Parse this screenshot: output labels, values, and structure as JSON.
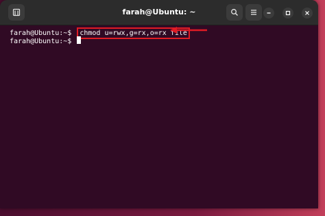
{
  "window": {
    "title": "farah@Ubuntu: ~"
  },
  "terminal": {
    "lines": [
      {
        "prompt": "farah@Ubuntu:~$",
        "command": "chmod u=rwx,g=rx,o=rx file"
      },
      {
        "prompt": "farah@Ubuntu:~$",
        "command": ""
      }
    ]
  },
  "icons": {
    "new_tab": "new-tab-icon",
    "search": "search-icon",
    "menu": "hamburger-menu-icon",
    "minimize": "minimize-icon",
    "maximize": "maximize-icon",
    "close": "close-icon"
  },
  "colors": {
    "terminal_bg": "#300a24",
    "highlight": "#e01b24",
    "titlebar": "#2c2c2c"
  }
}
